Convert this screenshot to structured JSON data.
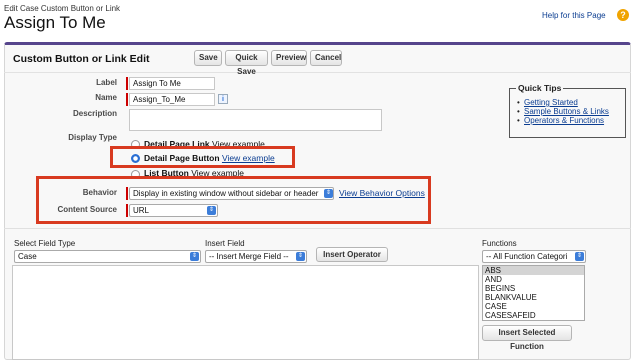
{
  "breadcrumb": "Edit Case Custom Button or Link",
  "title": "Assign To Me",
  "help": {
    "label": "Help for this Page",
    "icon": "help-circle-icon",
    "icon_glyph": "?"
  },
  "panel": {
    "title": "Custom Button or Link Edit",
    "buttons": {
      "save": "Save",
      "quick_save": "Quick Save",
      "preview": "Preview",
      "cancel": "Cancel"
    }
  },
  "fields": {
    "label": {
      "label": "Label",
      "value": "Assign To Me"
    },
    "name": {
      "label": "Name",
      "value": "Assign_To_Me",
      "info_icon": "i"
    },
    "description": {
      "label": "Description",
      "value": ""
    },
    "display_type": {
      "label": "Display Type",
      "options": [
        {
          "label": "Detail Page Link",
          "example": "View example",
          "selected": false
        },
        {
          "label": "Detail Page Button",
          "example": "View example",
          "selected": true
        },
        {
          "label": "List Button",
          "example": "View example",
          "selected": false
        }
      ]
    },
    "behavior": {
      "label": "Behavior",
      "value": "Display in existing window without sidebar or header",
      "link": "View Behavior Options"
    },
    "content_source": {
      "label": "Content Source",
      "value": "URL"
    }
  },
  "quick_tips": {
    "title": "Quick Tips",
    "items": [
      "Getting Started",
      "Sample Buttons & Links",
      "Operators & Functions"
    ]
  },
  "formula": {
    "select_field_type": {
      "label": "Select Field Type",
      "value": "Case"
    },
    "insert_field": {
      "label": "Insert Field",
      "value": "-- Insert Merge Field --"
    },
    "insert_operator": {
      "label": "Insert Operator",
      "arrow": "▼"
    },
    "functions": {
      "label": "Functions",
      "category": "-- All Function Categori",
      "items": [
        "ABS",
        "AND",
        "BEGINS",
        "BLANKVALUE",
        "CASE",
        "CASESAFEID"
      ],
      "insert_button": "Insert Selected Function"
    }
  },
  "colors": {
    "accent": "#56458c",
    "required": "#cc0000",
    "highlight": "#d83a20",
    "link": "#0b3d91"
  }
}
